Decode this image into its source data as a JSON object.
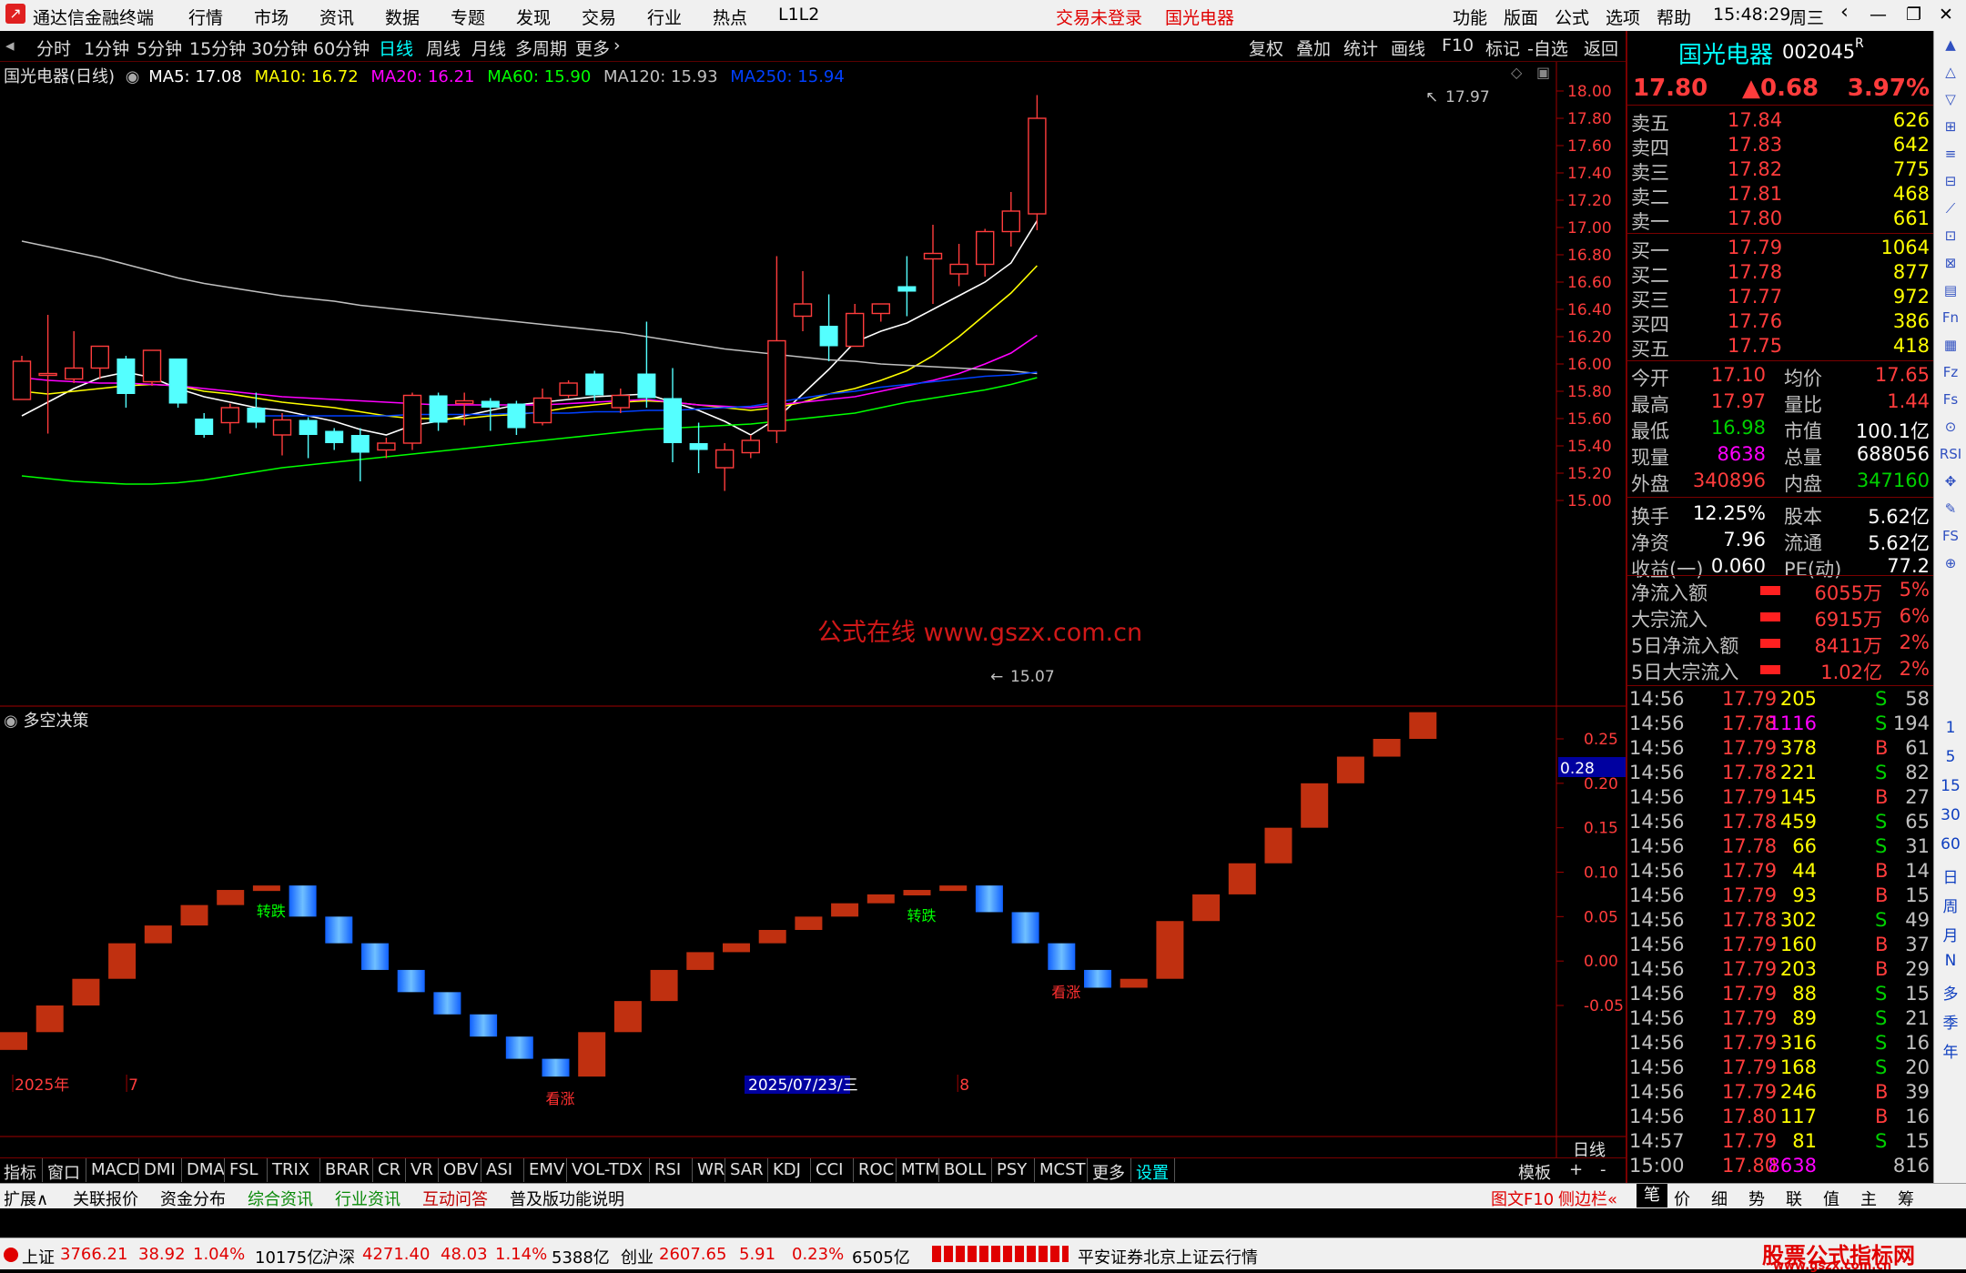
{
  "titlebar": {
    "app_name": "通达信金融终端",
    "menu": [
      "行情",
      "市场",
      "资讯",
      "数据",
      "专题",
      "发现",
      "交易",
      "行业",
      "热点",
      "L1L2"
    ],
    "login_status": "交易未登录",
    "stock_title": "国光电器",
    "right_menu": [
      "功能",
      "版面",
      "公式",
      "选项",
      "帮助"
    ],
    "time": "15:48:29",
    "weekday": "周三"
  },
  "periodbar": {
    "periods": [
      "分时",
      "1分钟",
      "5分钟",
      "15分钟",
      "30分钟",
      "60分钟",
      "日线",
      "周线",
      "月线",
      "多周期",
      "更多"
    ],
    "active": "日线",
    "tools": [
      "复权",
      "叠加",
      "统计",
      "画线",
      "F10",
      "标记",
      "-自选",
      "返回"
    ]
  },
  "main_chart": {
    "label": "国光电器(日线)",
    "ma_labels": [
      {
        "text": "MA5: 17.08",
        "color": "#ffffff"
      },
      {
        "text": "MA10: 16.72",
        "color": "#ffff00"
      },
      {
        "text": "MA20: 16.21",
        "color": "#ff00ff"
      },
      {
        "text": "MA60: 15.90",
        "color": "#00ff00"
      },
      {
        "text": "MA120: 15.93",
        "color": "#c0c0c0"
      },
      {
        "text": "MA250: 15.94",
        "color": "#0040ff"
      }
    ],
    "y_ticks": [
      "18.00",
      "17.80",
      "17.60",
      "17.40",
      "17.20",
      "17.00",
      "16.80",
      "16.60",
      "16.40",
      "16.20",
      "16.00",
      "15.80",
      "15.60",
      "15.40",
      "15.20",
      "15.00"
    ],
    "high_label": "17.97",
    "low_label": "15.07",
    "watermark": "公式在线 www.gszx.com.cn"
  },
  "chart_data": [
    {
      "type": "candlestick",
      "title": "国光电器(日线)",
      "ylim": [
        15.0,
        18.0
      ],
      "candles": [
        {
          "o": 15.74,
          "c": 16.02,
          "h": 16.06,
          "l": 15.74
        },
        {
          "o": 15.93,
          "c": 15.93,
          "h": 16.36,
          "l": 15.49
        },
        {
          "o": 15.89,
          "c": 15.97,
          "h": 16.24,
          "l": 15.86
        },
        {
          "o": 15.97,
          "c": 16.13,
          "h": 16.13,
          "l": 15.89
        },
        {
          "o": 16.04,
          "c": 15.78,
          "h": 16.06,
          "l": 15.68
        },
        {
          "o": 15.87,
          "c": 16.1,
          "h": 16.1,
          "l": 15.84
        },
        {
          "o": 16.04,
          "c": 15.71,
          "h": 16.04,
          "l": 15.68
        },
        {
          "o": 15.6,
          "c": 15.48,
          "h": 15.64,
          "l": 15.46
        },
        {
          "o": 15.57,
          "c": 15.68,
          "h": 15.71,
          "l": 15.49
        },
        {
          "o": 15.68,
          "c": 15.57,
          "h": 15.79,
          "l": 15.53
        },
        {
          "o": 15.48,
          "c": 15.59,
          "h": 15.64,
          "l": 15.33
        },
        {
          "o": 15.59,
          "c": 15.48,
          "h": 15.61,
          "l": 15.31
        },
        {
          "o": 15.51,
          "c": 15.42,
          "h": 15.53,
          "l": 15.37
        },
        {
          "o": 15.48,
          "c": 15.35,
          "h": 15.53,
          "l": 15.14
        },
        {
          "o": 15.37,
          "c": 15.42,
          "h": 15.46,
          "l": 15.31
        },
        {
          "o": 15.42,
          "c": 15.77,
          "h": 15.79,
          "l": 15.37
        },
        {
          "o": 15.77,
          "c": 15.57,
          "h": 15.79,
          "l": 15.51
        },
        {
          "o": 15.71,
          "c": 15.73,
          "h": 15.79,
          "l": 15.55
        },
        {
          "o": 15.73,
          "c": 15.68,
          "h": 15.75,
          "l": 15.51
        },
        {
          "o": 15.71,
          "c": 15.53,
          "h": 15.73,
          "l": 15.48
        },
        {
          "o": 15.57,
          "c": 15.75,
          "h": 15.82,
          "l": 15.55
        },
        {
          "o": 15.77,
          "c": 15.86,
          "h": 15.88,
          "l": 15.75
        },
        {
          "o": 15.93,
          "c": 15.77,
          "h": 15.95,
          "l": 15.73
        },
        {
          "o": 15.68,
          "c": 15.77,
          "h": 15.82,
          "l": 15.64
        },
        {
          "o": 15.93,
          "c": 15.75,
          "h": 16.31,
          "l": 15.68
        },
        {
          "o": 15.75,
          "c": 15.42,
          "h": 15.97,
          "l": 15.28
        },
        {
          "o": 15.42,
          "c": 15.37,
          "h": 15.57,
          "l": 15.2
        },
        {
          "o": 15.24,
          "c": 15.37,
          "h": 15.42,
          "l": 15.07
        },
        {
          "o": 15.35,
          "c": 15.44,
          "h": 15.48,
          "l": 15.31
        },
        {
          "o": 15.51,
          "c": 16.17,
          "h": 16.79,
          "l": 15.42
        },
        {
          "o": 16.35,
          "c": 16.44,
          "h": 16.68,
          "l": 16.24
        },
        {
          "o": 16.28,
          "c": 16.13,
          "h": 16.51,
          "l": 16.02
        },
        {
          "o": 16.13,
          "c": 16.37,
          "h": 16.44,
          "l": 16.13
        },
        {
          "o": 16.37,
          "c": 16.44,
          "h": 16.44,
          "l": 16.31
        },
        {
          "o": 16.57,
          "c": 16.53,
          "h": 16.79,
          "l": 16.35
        },
        {
          "o": 16.77,
          "c": 16.81,
          "h": 17.02,
          "l": 16.44
        },
        {
          "o": 16.66,
          "c": 16.73,
          "h": 16.88,
          "l": 16.57
        },
        {
          "o": 16.73,
          "c": 16.97,
          "h": 16.99,
          "l": 16.64
        },
        {
          "o": 16.97,
          "c": 17.12,
          "h": 17.26,
          "l": 16.86
        },
        {
          "o": 17.1,
          "c": 17.8,
          "h": 17.97,
          "l": 16.98
        }
      ],
      "series": [
        {
          "name": "MA5",
          "color": "#ffffff",
          "values": [
            15.62,
            15.72,
            15.82,
            15.9,
            15.94,
            15.9,
            15.82,
            15.76,
            15.72,
            15.68,
            15.66,
            15.62,
            15.58,
            15.52,
            15.48,
            15.55,
            15.58,
            15.62,
            15.66,
            15.7,
            15.72,
            15.74,
            15.76,
            15.77,
            15.78,
            15.72,
            15.66,
            15.58,
            15.48,
            15.6,
            15.78,
            15.96,
            16.16,
            16.24,
            16.3,
            16.4,
            16.5,
            16.6,
            16.74,
            17.05
          ]
        },
        {
          "name": "MA10",
          "color": "#ffff00",
          "values": [
            15.8,
            15.78,
            15.8,
            15.82,
            15.84,
            15.85,
            15.84,
            15.8,
            15.78,
            15.75,
            15.72,
            15.7,
            15.68,
            15.65,
            15.62,
            15.6,
            15.6,
            15.6,
            15.62,
            15.63,
            15.65,
            15.68,
            15.7,
            15.72,
            15.73,
            15.72,
            15.7,
            15.68,
            15.66,
            15.68,
            15.72,
            15.78,
            15.82,
            15.88,
            15.95,
            16.06,
            16.2,
            16.36,
            16.52,
            16.72
          ]
        },
        {
          "name": "MA20",
          "color": "#ff00ff",
          "values": [
            15.9,
            15.88,
            15.87,
            15.86,
            15.86,
            15.85,
            15.84,
            15.82,
            15.8,
            15.78,
            15.76,
            15.75,
            15.74,
            15.73,
            15.72,
            15.71,
            15.7,
            15.7,
            15.7,
            15.7,
            15.7,
            15.71,
            15.72,
            15.73,
            15.74,
            15.72,
            15.7,
            15.69,
            15.68,
            15.7,
            15.72,
            15.74,
            15.76,
            15.8,
            15.84,
            15.88,
            15.93,
            16.0,
            16.08,
            16.21
          ]
        },
        {
          "name": "MA60",
          "color": "#00ff00",
          "values": [
            15.18,
            15.16,
            15.14,
            15.13,
            15.12,
            15.12,
            15.13,
            15.15,
            15.18,
            15.21,
            15.24,
            15.26,
            15.28,
            15.3,
            15.32,
            15.34,
            15.36,
            15.38,
            15.4,
            15.42,
            15.44,
            15.46,
            15.48,
            15.5,
            15.52,
            15.53,
            15.54,
            15.55,
            15.56,
            15.58,
            15.6,
            15.62,
            15.64,
            15.68,
            15.72,
            15.75,
            15.78,
            15.81,
            15.85,
            15.9
          ]
        },
        {
          "name": "MA120",
          "color": "#c0c0c0",
          "values": [
            16.9,
            16.86,
            16.82,
            16.78,
            16.73,
            16.68,
            16.63,
            16.59,
            16.56,
            16.53,
            16.5,
            16.48,
            16.46,
            16.43,
            16.41,
            16.39,
            16.37,
            16.35,
            16.33,
            16.31,
            16.29,
            16.27,
            16.25,
            16.23,
            16.2,
            16.17,
            16.14,
            16.11,
            16.09,
            16.07,
            16.05,
            16.03,
            16.02,
            16.0,
            15.99,
            15.98,
            15.97,
            15.96,
            15.95,
            15.93
          ]
        },
        {
          "name": "MA250",
          "color": "#0040ff",
          "values": [
            null,
            null,
            null,
            null,
            null,
            null,
            null,
            null,
            null,
            15.62,
            15.62,
            15.62,
            15.62,
            15.62,
            15.62,
            15.63,
            15.63,
            15.63,
            15.63,
            15.64,
            15.64,
            15.64,
            15.65,
            15.65,
            15.66,
            15.66,
            15.67,
            15.68,
            15.69,
            15.72,
            15.75,
            15.78,
            15.8,
            15.83,
            15.85,
            15.87,
            15.89,
            15.91,
            15.92,
            15.94
          ]
        }
      ]
    },
    {
      "type": "bar",
      "title": "多空决策",
      "ylim": [
        -0.1,
        0.33
      ],
      "current_value": "0.28",
      "y_ticks": [
        "0.25",
        "0.20",
        "0.15",
        "0.10",
        "0.05",
        "0.00",
        "-0.05"
      ],
      "values": [
        -0.08,
        -0.05,
        -0.02,
        0.02,
        0.04,
        0.063,
        0.08,
        0.085,
        0.05,
        0.02,
        -0.01,
        -0.035,
        -0.06,
        -0.085,
        -0.11,
        -0.13,
        -0.08,
        -0.045,
        -0.01,
        0.01,
        0.02,
        0.035,
        0.05,
        0.065,
        0.075,
        0.08,
        0.085,
        0.055,
        0.02,
        -0.01,
        -0.03,
        -0.02,
        0.045,
        0.075,
        0.11,
        0.15,
        0.2,
        0.23,
        0.25,
        0.28
      ],
      "colors_up_down": [
        "#c03010",
        "#2080ff"
      ],
      "annotations": [
        {
          "index": 7,
          "text": "转跌"
        },
        {
          "index": 25,
          "text": "转跌"
        },
        {
          "index": 15,
          "text": "看涨"
        },
        {
          "index": 29,
          "text": "看涨"
        }
      ],
      "x_labels": [
        {
          "index": 0,
          "text": "2025年"
        },
        {
          "index": 3,
          "text": "7"
        },
        {
          "index": 20,
          "text": "2025/07/23/三"
        },
        {
          "index": 26,
          "text": "8"
        }
      ]
    }
  ],
  "indicator_title": "多空决策",
  "period_corner": "日线",
  "tabbar": {
    "items": [
      "指标",
      "窗口",
      "MACD",
      "DMI",
      "DMA",
      "FSL",
      "TRIX",
      "BRAR",
      "CR",
      "VR",
      "OBV",
      "ASI",
      "EMV",
      "VOL-TDX",
      "RSI",
      "WR",
      "SAR",
      "KDJ",
      "CCI",
      "ROC",
      "MTM",
      "BOLL",
      "PSY",
      "MCST",
      "更多",
      "设置"
    ],
    "right_items": [
      "模板",
      "+",
      "-"
    ]
  },
  "bottombar": {
    "items": [
      "扩展∧",
      "关联报价",
      "资金分布",
      "综合资讯",
      "行业资讯",
      "互动问答",
      "普及版功能说明"
    ],
    "right_items": [
      "图文F10",
      "侧边栏«"
    ],
    "panel_tabs": [
      "笔",
      "价",
      "细",
      "势",
      "联",
      "值",
      "主",
      "筹"
    ]
  },
  "quote": {
    "name": "国光电器",
    "code": "002045",
    "flag": "R",
    "price": "17.80",
    "change": "▲0.68",
    "pct": "3.97%",
    "asks": [
      {
        "label": "卖五",
        "price": "17.84",
        "vol": "626"
      },
      {
        "label": "卖四",
        "price": "17.83",
        "vol": "642"
      },
      {
        "label": "卖三",
        "price": "17.82",
        "vol": "775"
      },
      {
        "label": "卖二",
        "price": "17.81",
        "vol": "468"
      },
      {
        "label": "卖一",
        "price": "17.80",
        "vol": "661"
      }
    ],
    "bids": [
      {
        "label": "买一",
        "price": "17.79",
        "vol": "1064"
      },
      {
        "label": "买二",
        "price": "17.78",
        "vol": "877"
      },
      {
        "label": "买三",
        "price": "17.77",
        "vol": "972"
      },
      {
        "label": "买四",
        "price": "17.76",
        "vol": "386"
      },
      {
        "label": "买五",
        "price": "17.75",
        "vol": "418"
      }
    ],
    "stats": [
      {
        "l1": "今开",
        "v1": "17.10",
        "c1": "#ff3c3c",
        "l2": "均价",
        "v2": "17.65",
        "c2": "#ff3c3c"
      },
      {
        "l1": "最高",
        "v1": "17.97",
        "c1": "#ff3c3c",
        "l2": "量比",
        "v2": "1.44",
        "c2": "#ff3c3c"
      },
      {
        "l1": "最低",
        "v1": "16.98",
        "c1": "#00d000",
        "l2": "市值",
        "v2": "100.1亿",
        "c2": "#ffffff"
      },
      {
        "l1": "现量",
        "v1": "8638",
        "c1": "#ff00ff",
        "l2": "总量",
        "v2": "688056",
        "c2": "#ffffff"
      },
      {
        "l1": "外盘",
        "v1": "340896",
        "c1": "#ff3c3c",
        "l2": "内盘",
        "v2": "347160",
        "c2": "#00d000"
      }
    ],
    "stats2": [
      {
        "l1": "换手",
        "v1": "12.25%",
        "l2": "股本",
        "v2": "5.62亿"
      },
      {
        "l1": "净资",
        "v1": "7.96",
        "l2": "流通",
        "v2": "5.62亿"
      },
      {
        "l1": "收益(一)",
        "v1": "0.060",
        "l2": "PE(动)",
        "v2": "77.2"
      }
    ],
    "flows": [
      {
        "label": "净流入额",
        "value": "6055万",
        "pct": "5%"
      },
      {
        "label": "大宗流入",
        "value": "6915万",
        "pct": "6%"
      },
      {
        "label": "5日净流入额",
        "value": "8411万",
        "pct": "2%"
      },
      {
        "label": "5日大宗流入",
        "value": "1.02亿",
        "pct": "2%"
      }
    ],
    "ticks": [
      {
        "t": "14:56",
        "p": "17.79",
        "v": "205",
        "s": "S",
        "n": "58"
      },
      {
        "t": "14:56",
        "p": "17.78",
        "v": "1116",
        "s": "S",
        "n": "194"
      },
      {
        "t": "14:56",
        "p": "17.79",
        "v": "378",
        "s": "B",
        "n": "61"
      },
      {
        "t": "14:56",
        "p": "17.78",
        "v": "221",
        "s": "S",
        "n": "82"
      },
      {
        "t": "14:56",
        "p": "17.79",
        "v": "145",
        "s": "B",
        "n": "27"
      },
      {
        "t": "14:56",
        "p": "17.78",
        "v": "459",
        "s": "S",
        "n": "65"
      },
      {
        "t": "14:56",
        "p": "17.78",
        "v": "66",
        "s": "S",
        "n": "31"
      },
      {
        "t": "14:56",
        "p": "17.79",
        "v": "44",
        "s": "B",
        "n": "14"
      },
      {
        "t": "14:56",
        "p": "17.79",
        "v": "93",
        "s": "B",
        "n": "15"
      },
      {
        "t": "14:56",
        "p": "17.78",
        "v": "302",
        "s": "S",
        "n": "49"
      },
      {
        "t": "14:56",
        "p": "17.79",
        "v": "160",
        "s": "B",
        "n": "37"
      },
      {
        "t": "14:56",
        "p": "17.79",
        "v": "203",
        "s": "B",
        "n": "29"
      },
      {
        "t": "14:56",
        "p": "17.79",
        "v": "88",
        "s": "S",
        "n": "15"
      },
      {
        "t": "14:56",
        "p": "17.79",
        "v": "89",
        "s": "S",
        "n": "21"
      },
      {
        "t": "14:56",
        "p": "17.79",
        "v": "316",
        "s": "S",
        "n": "16"
      },
      {
        "t": "14:56",
        "p": "17.79",
        "v": "168",
        "s": "S",
        "n": "20"
      },
      {
        "t": "14:56",
        "p": "17.79",
        "v": "246",
        "s": "B",
        "n": "39"
      },
      {
        "t": "14:56",
        "p": "17.80",
        "v": "117",
        "s": "B",
        "n": "16"
      },
      {
        "t": "14:57",
        "p": "17.79",
        "v": "81",
        "s": "S",
        "n": "15"
      },
      {
        "t": "15:00",
        "p": "17.80",
        "v": "8638",
        "s": "",
        "n": "816"
      }
    ]
  },
  "sidebar": {
    "labels": [
      "1",
      "5",
      "15",
      "30",
      "60",
      "日",
      "周",
      "月",
      "N",
      "多",
      "季",
      "年"
    ]
  },
  "statusbar": {
    "sh_label": "上证",
    "sh_value": "3766.21",
    "sh_change": "38.92",
    "sh_pct": "1.04%",
    "sh_amount": "10175亿",
    "sz_label": "沪深",
    "sz_value": "4271.40",
    "sz_change": "48.03",
    "sz_pct": "1.14%",
    "sz_amount": "5388亿",
    "cy_label": "创业",
    "cy_value": "2607.65",
    "cy_change": "5.91",
    "cy_pct": "0.23%",
    "cy_amount": "6505亿",
    "server": "平安证券北京上证云行情",
    "brand": "股票公式指标网",
    "brand_url": "www.gszx.com.cn"
  }
}
